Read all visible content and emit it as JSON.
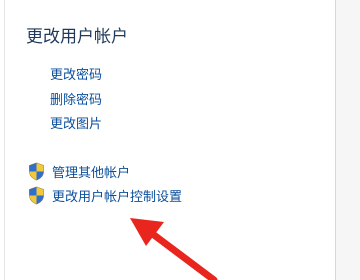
{
  "panel": {
    "title": "更改用户帐户",
    "links": [
      {
        "label": "更改密码"
      },
      {
        "label": "删除密码"
      },
      {
        "label": "更改图片"
      }
    ],
    "shield_links": [
      {
        "label": "管理其他帐户",
        "icon": "uac-shield-icon"
      },
      {
        "label": "更改用户帐户控制设置",
        "icon": "uac-shield-icon"
      }
    ]
  },
  "colors": {
    "link": "#0a4e9b",
    "title": "#1e395b",
    "arrow": "#e8261e"
  }
}
